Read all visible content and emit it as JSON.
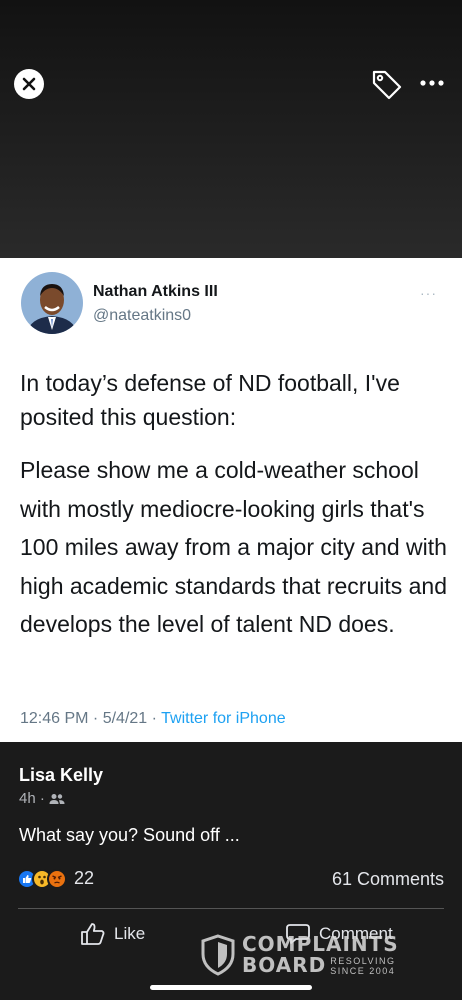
{
  "viewer": {
    "close_icon": "close-icon",
    "tag_icon": "tag-icon",
    "more_icon": "more-horizontal-icon"
  },
  "tweet": {
    "name": "Nathan Atkins III",
    "handle": "@nateatkins0",
    "menu_dots": "···",
    "text_intro": "In today’s defense of ND football, I've posited this question:",
    "text_body": "Please show me a cold-weather school with mostly mediocre-looking girls that's 100 miles away from a major city and with high academic standards that recruits and develops the level of talent ND does.",
    "timestamp": "12:46 PM · 5/4/21 · ",
    "source": "Twitter for iPhone"
  },
  "post": {
    "author": "Lisa Kelly",
    "time": "4h ·",
    "audience_icon": "friends-icon",
    "caption": "What say you? Sound off ...",
    "reaction_icons": [
      "like-reaction-icon",
      "wow-reaction-icon",
      "angry-reaction-icon"
    ],
    "reaction_count": "22",
    "comments_count": "61 Comments",
    "like_label": "Like",
    "comment_label": "Comment"
  },
  "watermark": {
    "line1": "COMPLAINTS",
    "line2": "BOARD",
    "sub1": "RESOLVING",
    "sub2": "SINCE 2004"
  },
  "colors": {
    "background": "#1b1b1b",
    "twitter_blue": "#1da1f2",
    "like_blue": "#1877f2"
  }
}
